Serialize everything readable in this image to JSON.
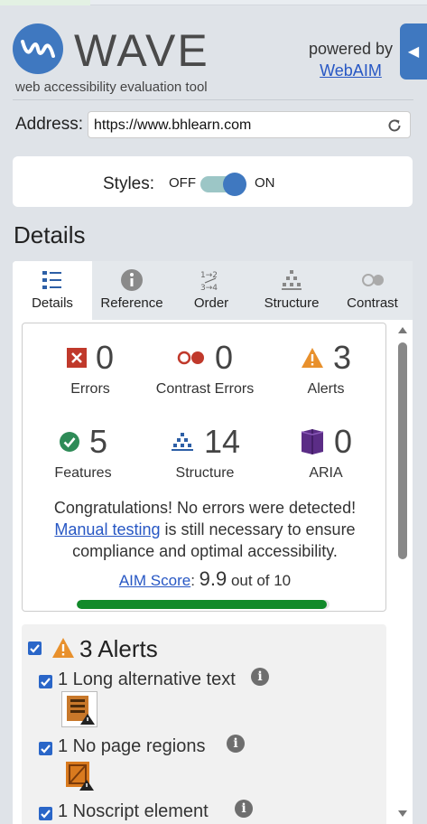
{
  "header": {
    "brand": "WAVE",
    "tagline": "web accessibility evaluation tool",
    "powered_by": "powered by",
    "powered_link": "WebAIM",
    "collapse_icon": "triangle-left-icon"
  },
  "address": {
    "label": "Address:",
    "value": "https://www.bhlearn.com"
  },
  "styles": {
    "label": "Styles:",
    "off": "OFF",
    "on": "ON",
    "state": "on"
  },
  "section_heading": "Details",
  "tabs": [
    {
      "label": "Details",
      "icon": "list-icon",
      "active": true
    },
    {
      "label": "Reference",
      "icon": "info-icon",
      "active": false
    },
    {
      "label": "Order",
      "icon": "order-icon",
      "active": false
    },
    {
      "label": "Structure",
      "icon": "structure-icon",
      "active": false
    },
    {
      "label": "Contrast",
      "icon": "contrast-icon",
      "active": false
    }
  ],
  "summary": {
    "errors": {
      "value": "0",
      "label": "Errors"
    },
    "contrast_errors": {
      "value": "0",
      "label": "Contrast Errors"
    },
    "alerts": {
      "value": "3",
      "label": "Alerts"
    },
    "features": {
      "value": "5",
      "label": "Features"
    },
    "structure": {
      "value": "14",
      "label": "Structure"
    },
    "aria": {
      "value": "0",
      "label": "ARIA"
    }
  },
  "congrats": {
    "line1": "Congratulations! No errors were detected!",
    "manual_link": "Manual testing",
    "line2_rest": " is still necessary to ensure",
    "line3": "compliance and optimal accessibility."
  },
  "aim": {
    "link": "AIM Score",
    "colon": ": ",
    "score": "9.9",
    "suffix": " out of 10",
    "fraction": 0.99
  },
  "alerts_section": {
    "heading": "3 Alerts",
    "items": [
      {
        "label": "1 Long alternative text"
      },
      {
        "label": "1 No page regions"
      },
      {
        "label": "1 Noscript element"
      }
    ]
  },
  "colors": {
    "accent": "#3f78c0",
    "error": "#c0392b",
    "alert": "#e8902c",
    "feature": "#2e8b57",
    "aim_bar": "#128a2a",
    "link": "#2757c4"
  }
}
